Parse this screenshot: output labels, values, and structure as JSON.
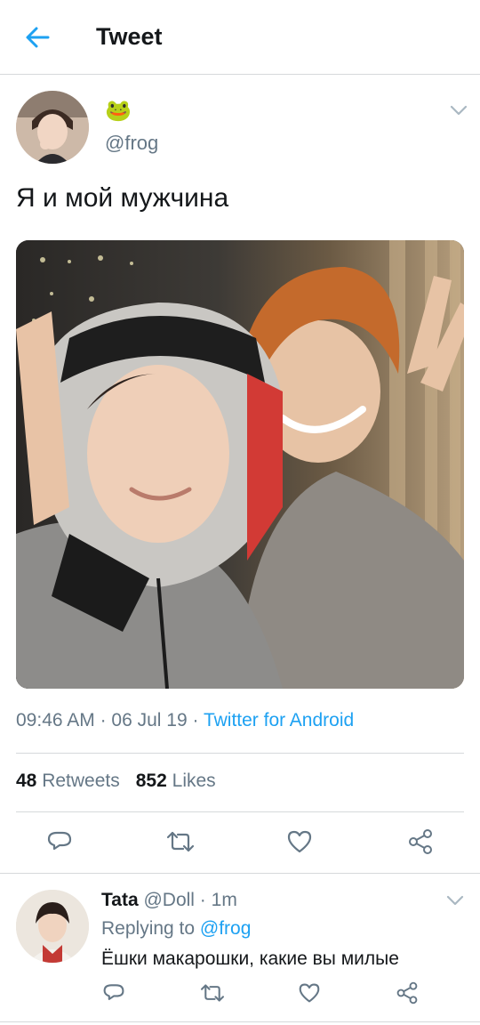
{
  "header": {
    "title": "Tweet"
  },
  "tweet": {
    "author_emoji": "🐸",
    "handle": "@frog",
    "text": "Я и мой мужчина",
    "time": "09:46 AM",
    "dot1": " · ",
    "date": "06 Jul 19",
    "dot2": " · ",
    "source": "Twitter for Android",
    "retweets_count": "48",
    "retweets_label": "Retweets",
    "likes_count": "852",
    "likes_label": "Likes"
  },
  "reply": {
    "name": "Tata",
    "handle": "@Doll",
    "dot": " · ",
    "time": "1m",
    "replying_prefix": "Replying to ",
    "replying_to": "@frog",
    "text": "Ёшки макарошки, какие вы милые"
  },
  "icons": {
    "back": "back-arrow-icon",
    "chevron": "chevron-down-icon",
    "reply": "reply-icon",
    "retweet": "retweet-icon",
    "like": "heart-icon",
    "share": "share-icon"
  },
  "colors": {
    "accent": "#1da1f2",
    "secondary_text": "#657786",
    "primary_text": "#14171a",
    "divider": "#d6d9db"
  }
}
